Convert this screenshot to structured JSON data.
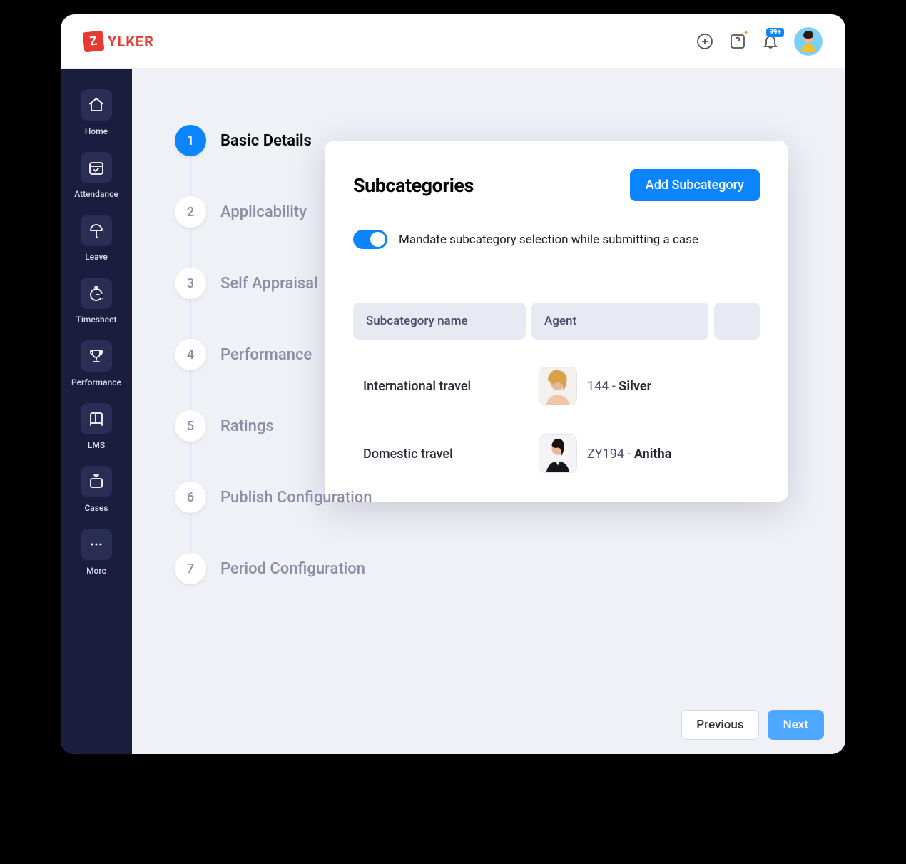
{
  "brand": {
    "mark": "Z",
    "name": "YLKER"
  },
  "header": {
    "notif_badge": "99+"
  },
  "sidebar": [
    {
      "key": "home",
      "label": "Home"
    },
    {
      "key": "attendance",
      "label": "Attendance"
    },
    {
      "key": "leave",
      "label": "Leave"
    },
    {
      "key": "timesheet",
      "label": "Timesheet"
    },
    {
      "key": "performance",
      "label": "Performance"
    },
    {
      "key": "lms",
      "label": "LMS"
    },
    {
      "key": "cases",
      "label": "Cases"
    },
    {
      "key": "more",
      "label": "More"
    }
  ],
  "stepper": [
    {
      "num": "1",
      "label": "Basic Details",
      "active": true
    },
    {
      "num": "2",
      "label": "Applicability"
    },
    {
      "num": "3",
      "label": "Self Appraisal"
    },
    {
      "num": "4",
      "label": "Performance"
    },
    {
      "num": "5",
      "label": "Ratings"
    },
    {
      "num": "6",
      "label": "Publish Configuration"
    },
    {
      "num": "7",
      "label": "Period Configuration"
    }
  ],
  "panel": {
    "title": "Subcategories",
    "add_btn": "Add Subcategory",
    "toggle_label": "Mandate subcategory selection while submitting a case",
    "columns": {
      "c1": "Subcategory name",
      "c2": "Agent"
    },
    "rows": [
      {
        "name": "International travel",
        "code": "144",
        "agent": "Silver"
      },
      {
        "name": "Domestic travel",
        "code": "ZY194",
        "agent": "Anitha"
      }
    ]
  },
  "footer": {
    "prev": "Previous",
    "next": "Next"
  }
}
